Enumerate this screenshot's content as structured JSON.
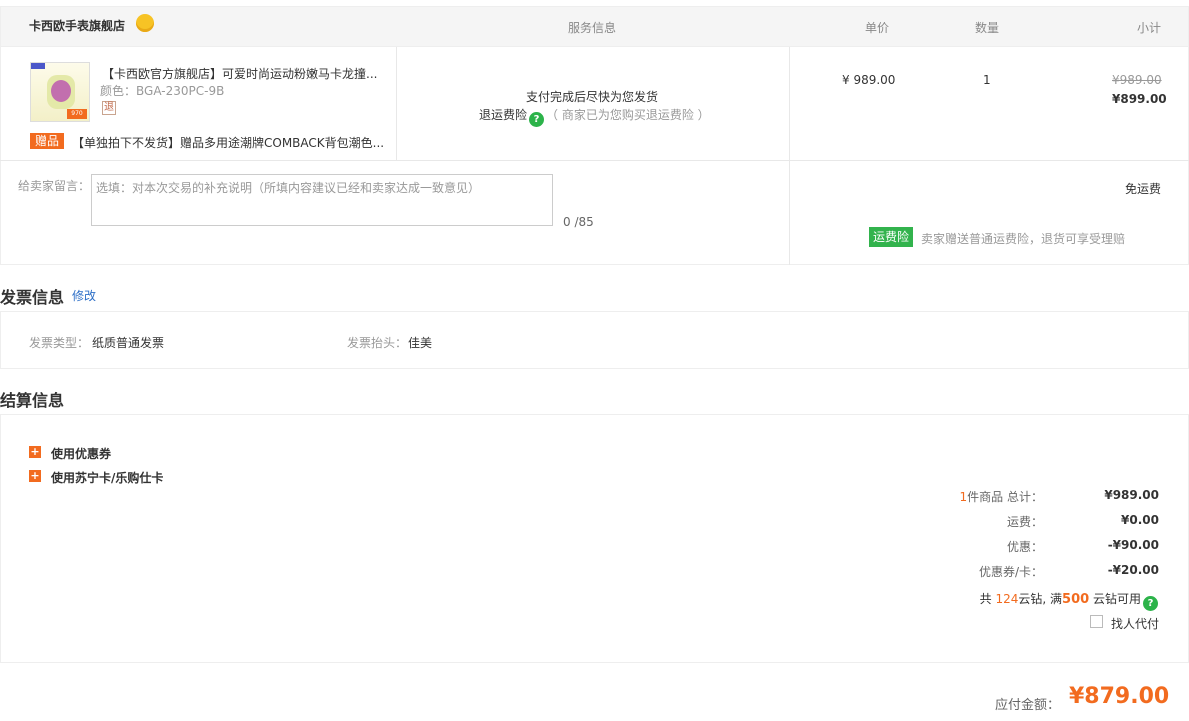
{
  "order": {
    "shop_name": "卡西欧手表旗舰店",
    "shop_badge_icon": "crown-badge-icon",
    "columns": {
      "service": "服务信息",
      "unit_price": "单价",
      "quantity": "数量",
      "subtotal": "小计"
    },
    "item": {
      "title": "【卡西欧官方旗舰店】可爱时尚运动粉嫩马卡龙撞...",
      "color": "颜色：BGA-230PC-9B",
      "refund_tag": "退",
      "thumb_price": "970",
      "gift_tag": "赠品",
      "gift_text": "【单独拍下不发货】赠品多用途潮牌COMBACK背包潮色...",
      "service_line1": "支付完成后尽快为您发货",
      "service_insurance": "退运费险",
      "service_note": "（ 商家已为您购买退运费险 ）",
      "unit_price": "¥ 989.00",
      "quantity": "1",
      "original_subtotal": "¥989.00",
      "subtotal": "¥899.00"
    },
    "message": {
      "label": "给卖家留言：",
      "placeholder": "选填：对本次交易的补充说明（所填内容建议已经和卖家达成一致意见）",
      "count": "0 /85"
    },
    "shipping": {
      "free": "免运费",
      "insurance_tag": "运费险",
      "insurance_text": "卖家赠送普通运费险，退货可享受理赔"
    }
  },
  "invoice": {
    "title": "发票信息",
    "edit": "修改",
    "type_label": "发票类型：",
    "type_value": "纸质普通发票",
    "head_label": "发票抬头：",
    "head_value": "佳美"
  },
  "settlement": {
    "title": "结算信息",
    "options": [
      "使用优惠券",
      "使用苏宁卡/乐购仕卡"
    ],
    "summary": [
      {
        "label_prefix": "1",
        "label": "件商品  总计：",
        "value": "¥989.00"
      },
      {
        "label_prefix": "",
        "label": "运费：",
        "value": "¥0.00"
      },
      {
        "label_prefix": "",
        "label": "优惠：",
        "value": "-¥90.00"
      },
      {
        "label_prefix": "",
        "label": "优惠券/卡：",
        "value": "-¥20.00"
      }
    ],
    "yunzuan": {
      "prefix": "共 ",
      "count": "124",
      "mid": "云钻, 满",
      "threshold": "500",
      "suffix": " 云钻可用"
    },
    "proxy_pay": "找人代付",
    "payable_label": "应付金额：",
    "payable_value": "¥879.00"
  },
  "colors": {
    "accent_orange": "#f26b1f",
    "green": "#2cb34a",
    "link_blue": "#2d6fc7"
  }
}
